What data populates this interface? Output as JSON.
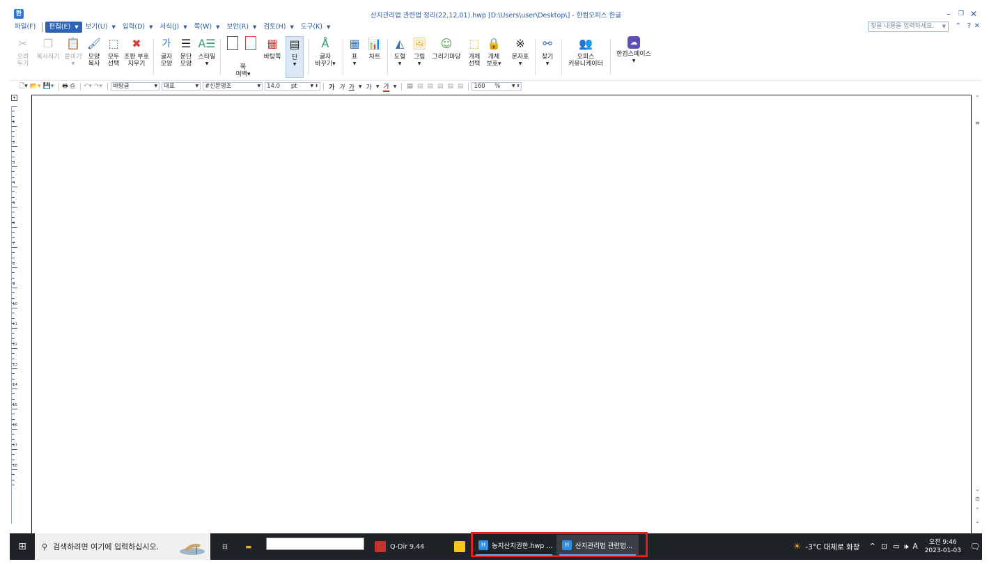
{
  "window": {
    "title": "산지관리법 관련법 정리(22,12,01).hwp [D:\\Users\\user\\Desktop\\] - 한컴오피스 한글",
    "app_icon": "hwp-icon",
    "controls": [
      "minimize",
      "restore",
      "close"
    ]
  },
  "menu": {
    "items": [
      {
        "label": "파일(F)",
        "has_arrow": false
      },
      {
        "label": "편집(E)",
        "has_arrow": true,
        "active": true
      },
      {
        "label": "보기(U)",
        "has_arrow": true
      },
      {
        "label": "입력(D)",
        "has_arrow": true
      },
      {
        "label": "서식(J)",
        "has_arrow": true
      },
      {
        "label": "쪽(W)",
        "has_arrow": true
      },
      {
        "label": "보안(R)",
        "has_arrow": true
      },
      {
        "label": "검토(H)",
        "has_arrow": true
      },
      {
        "label": "도구(K)",
        "has_arrow": true
      }
    ],
    "search_placeholder": "찾을 내용을 입력하세요."
  },
  "ribbon": {
    "tools": [
      {
        "name": "cut",
        "label": "오려\n두기",
        "icon": "scissors-icon",
        "disabled": true
      },
      {
        "name": "copy",
        "label": "복사하기",
        "icon": "copy-icon",
        "disabled": true
      },
      {
        "name": "paste",
        "label": "붙이기",
        "icon": "paste-icon",
        "disabled": true
      },
      {
        "name": "format-copy",
        "label": "모양\n복사",
        "icon": "brush-icon"
      },
      {
        "name": "select-all",
        "label": "모두\n선택",
        "icon": "cursor-icon"
      },
      {
        "name": "clear-marks",
        "label": "조판 부호\n지우기",
        "icon": "eraser-icon"
      },
      {
        "name": "char-shape",
        "label": "글자\n모양",
        "icon": "char-shape-icon"
      },
      {
        "name": "para-shape",
        "label": "문단\n모양",
        "icon": "para-shape-icon"
      },
      {
        "name": "style",
        "label": "스타일",
        "icon": "style-icon"
      },
      {
        "name": "page-margin",
        "label": "쪽\n여백",
        "icon": "page-icon"
      },
      {
        "name": "background",
        "label": "바탕쪽",
        "icon": "background-icon"
      },
      {
        "name": "columns",
        "label": "단",
        "icon": "columns-icon",
        "selected": true
      },
      {
        "name": "replace-char",
        "label": "글자\n바꾸기",
        "icon": "replace-icon"
      },
      {
        "name": "table",
        "label": "표",
        "icon": "table-icon"
      },
      {
        "name": "chart",
        "label": "차트",
        "icon": "chart-icon"
      },
      {
        "name": "shape",
        "label": "도형",
        "icon": "shape-icon"
      },
      {
        "name": "picture",
        "label": "그림",
        "icon": "picture-icon"
      },
      {
        "name": "drawing-gallery",
        "label": "그리기마당",
        "icon": "gallery-icon"
      },
      {
        "name": "object-select",
        "label": "개체\n선택",
        "icon": "object-select-icon"
      },
      {
        "name": "object-protect",
        "label": "개체\n보호",
        "icon": "lock-icon"
      },
      {
        "name": "symbols",
        "label": "문자표",
        "icon": "symbol-icon"
      },
      {
        "name": "find",
        "label": "찾기",
        "icon": "binoculars-icon"
      },
      {
        "name": "office-comm",
        "label": "오피스\n커뮤니케이터",
        "icon": "people-icon"
      },
      {
        "name": "hancom-space",
        "label": "한컴스페이스",
        "icon": "cloud-icon"
      }
    ]
  },
  "format_bar": {
    "style": "바탕글",
    "language": "대표",
    "font": "#신문명조",
    "size": "14.0",
    "size_unit": "pt",
    "zoom": "160",
    "zoom_unit": "%",
    "bold_label": "가",
    "italic_label": "가",
    "underline_label": "가",
    "strike_label": "가",
    "color_label": "가"
  },
  "ruler": {
    "marks": [
      "1",
      "2",
      "3",
      "4",
      "5",
      "6",
      "7",
      "8",
      "9",
      "10",
      "11",
      "12",
      "13",
      "14",
      "15",
      "16",
      "17",
      "18"
    ]
  },
  "taskbar": {
    "search_placeholder": "검색하려면 여기에 입력하십시오.",
    "qdir_label": "Q-Dir 9.44",
    "hwp_buttons": [
      "농지산지권한.hwp ...",
      "산지관리법 관련법..."
    ],
    "weather": "-3°C  대체로 화창",
    "ime": "A",
    "time": "오전 9:46",
    "date": "2023-01-03"
  },
  "colors": {
    "menu_text": "#2a5aa8",
    "active_menu": "#2c63b5",
    "taskbar": "#1f2227",
    "highlight": "#e41e1e"
  }
}
